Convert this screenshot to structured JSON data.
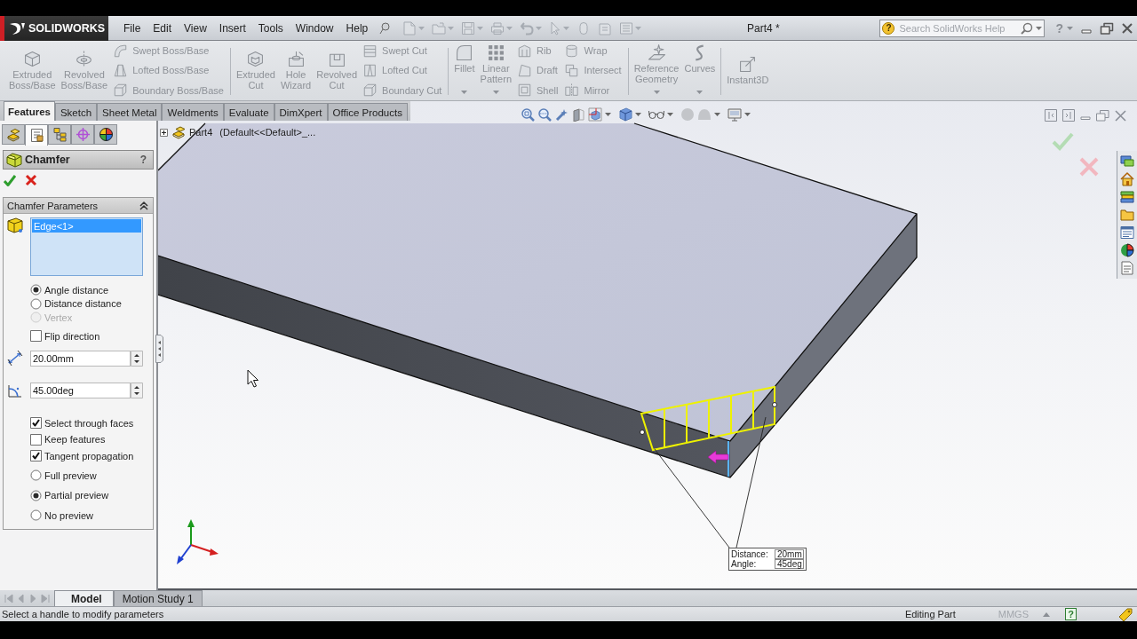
{
  "title_bar": {
    "logo": "SOLIDWORKS",
    "menu": [
      "File",
      "Edit",
      "View",
      "Insert",
      "Tools",
      "Window",
      "Help"
    ],
    "document": "Part4 *",
    "search": {
      "help_mark": "?",
      "placeholder": "Search SolidWorks Help"
    },
    "help_mark": "?"
  },
  "ribbon": {
    "disabled": true,
    "groups": [
      {
        "tools": [
          {
            "kind": "large",
            "label": "Extruded\nBoss/Base",
            "dropdown": false
          },
          {
            "kind": "large",
            "label": "Revolved\nBoss/Base",
            "dropdown": false
          },
          {
            "kind": "stack",
            "items": [
              "Swept Boss/Base",
              "Lofted Boss/Base",
              "Boundary Boss/Base"
            ]
          }
        ]
      },
      {
        "tools": [
          {
            "kind": "large",
            "label": "Extruded\nCut",
            "dropdown": false
          },
          {
            "kind": "large",
            "label": "Hole\nWizard",
            "dropdown": false
          },
          {
            "kind": "large",
            "label": "Revolved\nCut",
            "dropdown": false
          },
          {
            "kind": "stack",
            "items": [
              "Swept Cut",
              "Lofted Cut",
              "Boundary Cut"
            ]
          }
        ]
      },
      {
        "tools": [
          {
            "kind": "large",
            "label": "Fillet",
            "dropdown": true
          },
          {
            "kind": "large",
            "label": "Linear\nPattern",
            "dropdown": true
          },
          {
            "kind": "stack",
            "items": [
              "Rib",
              "Draft",
              "Shell"
            ]
          },
          {
            "kind": "stack",
            "items": [
              "Wrap",
              "Intersect",
              "Mirror"
            ]
          }
        ]
      },
      {
        "tools": [
          {
            "kind": "large",
            "label": "Reference\nGeometry",
            "dropdown": true
          },
          {
            "kind": "large",
            "label": "Curves",
            "dropdown": true
          }
        ]
      },
      {
        "tools": [
          {
            "kind": "large",
            "label": "Instant3D",
            "dropdown": false
          }
        ]
      }
    ]
  },
  "command_tabs": [
    {
      "label": "Features",
      "selected": true
    },
    {
      "label": "Sketch",
      "selected": false
    },
    {
      "label": "Sheet Metal",
      "selected": false
    },
    {
      "label": "Weldments",
      "selected": false
    },
    {
      "label": "Evaluate",
      "selected": false
    },
    {
      "label": "DimXpert",
      "selected": false
    },
    {
      "label": "Office Products",
      "selected": false
    }
  ],
  "property_manager": {
    "panel_tabs": [
      {
        "kind": "tree",
        "selected": false
      },
      {
        "kind": "properties",
        "selected": true
      },
      {
        "kind": "config",
        "selected": false
      },
      {
        "kind": "target",
        "selected": false
      },
      {
        "kind": "display",
        "selected": false
      }
    ],
    "title": "Chamfer",
    "help_mark": "?",
    "section": {
      "title": "Chamfer Parameters",
      "expanded": true,
      "selection_list": [
        {
          "label": "Edge<1>",
          "selected": true
        }
      ],
      "chamfer_type": [
        {
          "label": "Angle distance",
          "selected": true,
          "disabled": false
        },
        {
          "label": "Distance distance",
          "selected": false,
          "disabled": false
        },
        {
          "label": "Vertex",
          "selected": false,
          "disabled": true
        }
      ],
      "flip_direction": {
        "label": "Flip direction",
        "checked": false
      },
      "distance": {
        "value": "20.00mm"
      },
      "angle": {
        "value": "45.00deg"
      },
      "options": [
        {
          "label": "Select through faces",
          "checked": true
        },
        {
          "label": "Keep features",
          "checked": false
        },
        {
          "label": "Tangent propagation",
          "checked": true
        }
      ],
      "preview": [
        {
          "label": "Full preview",
          "selected": false
        },
        {
          "label": "Partial preview",
          "selected": true
        },
        {
          "label": "No preview",
          "selected": false
        }
      ]
    }
  },
  "viewport": {
    "breadcrumb": {
      "part": "Part4",
      "configuration": "(Default<<Default>_..."
    },
    "callout": [
      {
        "label": "Distance:",
        "value": "20mm"
      },
      {
        "label": "Angle:",
        "value": "45deg"
      }
    ]
  },
  "model_tabs": [
    {
      "label": "Model",
      "selected": true
    },
    {
      "label": "Motion Study 1",
      "selected": false
    }
  ],
  "status_bar": {
    "message": "Select a handle to modify parameters",
    "mode": "Editing Part",
    "units": "MMGS",
    "help_mark": "?"
  }
}
